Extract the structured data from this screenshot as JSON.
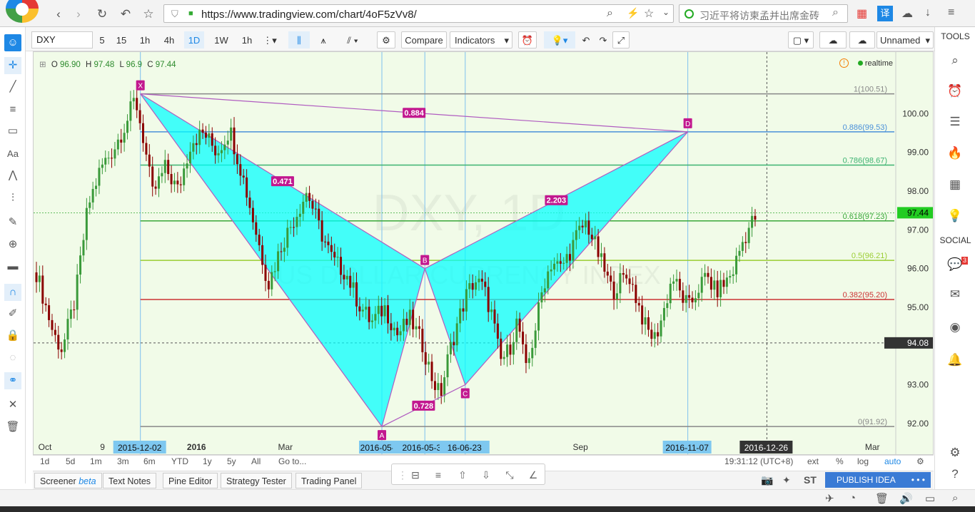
{
  "browser": {
    "url": "https://www.tradingview.com/chart/4oF5zVv8/",
    "search_text": "习近平将访柬孟并出席金砖",
    "translate_label": "译"
  },
  "toolbar": {
    "symbol": "DXY",
    "intervals": [
      "5",
      "15",
      "1h",
      "4h",
      "1D",
      "1W",
      "1h"
    ],
    "active_interval": "1D",
    "compare": "Compare",
    "indicators": "Indicators",
    "layout_name": "Unnamed"
  },
  "legend": {
    "o_label": "O",
    "o_value": "96.90",
    "h_label": "H",
    "h_value": "97.48",
    "l_label": "L",
    "l_value": "96.9",
    "c_label": "C",
    "c_value": "97.44",
    "realtime": "realtime"
  },
  "watermark": {
    "title": "DXY, 1D",
    "subtitle": "US DOLLAR CURRENCY INDEX"
  },
  "chart_data": {
    "type": "candlestick",
    "symbol": "DXY",
    "interval": "1D",
    "y_ticks": [
      "100.00",
      "99.00",
      "98.00",
      "97.00",
      "96.00",
      "95.00",
      "93.00",
      "92.00"
    ],
    "ylim": [
      91.5,
      101.0
    ],
    "last_price": "97.44",
    "crosshair_price": "94.08",
    "x_ticks": [
      "Oct",
      "9",
      "2016",
      "Mar",
      "Sep",
      "Mar"
    ],
    "x_highlight_dates": [
      "2015-12-02",
      "2016-05-0(",
      "2016-05-30",
      "16-06-23",
      "2016-11-07",
      "2016-12-26"
    ],
    "fib_levels": [
      {
        "label": "1(100.51)",
        "value": 100.51,
        "color": "#888888"
      },
      {
        "label": "0.886(99.53)",
        "value": 99.53,
        "color": "#4a90d9"
      },
      {
        "label": "0.786(98.67)",
        "value": 98.67,
        "color": "#3cb371"
      },
      {
        "label": "0.618(97.23)",
        "value": 97.23,
        "color": "#3aa83a"
      },
      {
        "label": "0.5(96.21)",
        "value": 96.21,
        "color": "#9acd32"
      },
      {
        "label": "0.382(95.20)",
        "value": 95.2,
        "color": "#cc3333"
      },
      {
        "label": "0(91.92)",
        "value": 91.92,
        "color": "#888888"
      }
    ],
    "pattern": {
      "points": [
        {
          "label": "X",
          "date": "2015-12-02",
          "value": 100.51
        },
        {
          "label": "A",
          "date": "2016-05-03",
          "value": 91.92
        },
        {
          "label": "B",
          "date": "2016-05-30",
          "value": 96.0
        },
        {
          "label": "C",
          "date": "2016-06-23",
          "value": 93.0
        },
        {
          "label": "D",
          "date": "2016-11-07",
          "value": 99.53
        }
      ],
      "ratios": [
        "0.884",
        "0.471",
        "0.728",
        "2.203"
      ]
    },
    "candles_close_path": [
      [
        0.0,
        95.9
      ],
      [
        0.02,
        94.3
      ],
      [
        0.03,
        93.9
      ],
      [
        0.045,
        95.2
      ],
      [
        0.06,
        97.6
      ],
      [
        0.075,
        98.6
      ],
      [
        0.09,
        99.1
      ],
      [
        0.105,
        99.8
      ],
      [
        0.115,
        100.4
      ],
      [
        0.125,
        99.3
      ],
      [
        0.135,
        97.9
      ],
      [
        0.15,
        98.6
      ],
      [
        0.165,
        98.0
      ],
      [
        0.18,
        99.3
      ],
      [
        0.195,
        99.5
      ],
      [
        0.21,
        99.0
      ],
      [
        0.225,
        99.6
      ],
      [
        0.24,
        98.4
      ],
      [
        0.255,
        97.0
      ],
      [
        0.27,
        95.6
      ],
      [
        0.285,
        96.6
      ],
      [
        0.3,
        97.3
      ],
      [
        0.315,
        98.0
      ],
      [
        0.33,
        97.0
      ],
      [
        0.345,
        96.2
      ],
      [
        0.36,
        95.9
      ],
      [
        0.375,
        95.1
      ],
      [
        0.39,
        94.6
      ],
      [
        0.405,
        95.0
      ],
      [
        0.42,
        94.3
      ],
      [
        0.435,
        94.7
      ],
      [
        0.45,
        94.0
      ],
      [
        0.46,
        93.2
      ],
      [
        0.47,
        92.7
      ],
      [
        0.48,
        93.8
      ],
      [
        0.49,
        94.6
      ],
      [
        0.5,
        95.3
      ],
      [
        0.51,
        95.7
      ],
      [
        0.52,
        95.5
      ],
      [
        0.53,
        94.8
      ],
      [
        0.54,
        93.6
      ],
      [
        0.55,
        93.9
      ],
      [
        0.56,
        94.7
      ],
      [
        0.57,
        93.3
      ],
      [
        0.58,
        94.4
      ],
      [
        0.59,
        95.6
      ],
      [
        0.6,
        96.2
      ],
      [
        0.61,
        96.0
      ],
      [
        0.62,
        96.4
      ],
      [
        0.63,
        96.9
      ],
      [
        0.64,
        97.2
      ],
      [
        0.65,
        96.6
      ],
      [
        0.66,
        96.0
      ],
      [
        0.67,
        95.4
      ],
      [
        0.68,
        95.7
      ],
      [
        0.69,
        95.8
      ],
      [
        0.7,
        95.1
      ],
      [
        0.71,
        94.4
      ],
      [
        0.72,
        94.2
      ],
      [
        0.73,
        94.9
      ],
      [
        0.74,
        95.8
      ],
      [
        0.75,
        95.3
      ],
      [
        0.76,
        95.0
      ],
      [
        0.77,
        95.5
      ],
      [
        0.78,
        95.8
      ],
      [
        0.79,
        95.4
      ],
      [
        0.8,
        95.6
      ],
      [
        0.81,
        95.9
      ],
      [
        0.82,
        96.6
      ],
      [
        0.83,
        97.1
      ],
      [
        0.84,
        97.44
      ]
    ]
  },
  "time_range": [
    "1d",
    "5d",
    "1m",
    "3m",
    "6m",
    "YTD",
    "1y",
    "5y",
    "All",
    "Go to..."
  ],
  "status": {
    "clock": "19:31:12 (UTC+8)",
    "ext": "ext",
    "percent": "%",
    "log": "log",
    "auto": "auto"
  },
  "bottom_tabs": [
    "Screener",
    "Text Notes",
    "Pine Editor",
    "Strategy Tester",
    "Trading Panel"
  ],
  "screener_suffix": "beta",
  "publish": "PUBLISH IDEA",
  "right_panel": {
    "tools_label": "TOOLS",
    "social_label": "SOCIAL",
    "notif_count": "3"
  },
  "bottom_status": {
    "share_label": "ST"
  },
  "colors": {
    "pattern_fill": "#00ffff",
    "pattern_stroke": "#b05cc0",
    "label_bg": "#c2188f",
    "up": "#3a9a3a",
    "down": "#8b0000",
    "accent": "#1e88e5"
  }
}
